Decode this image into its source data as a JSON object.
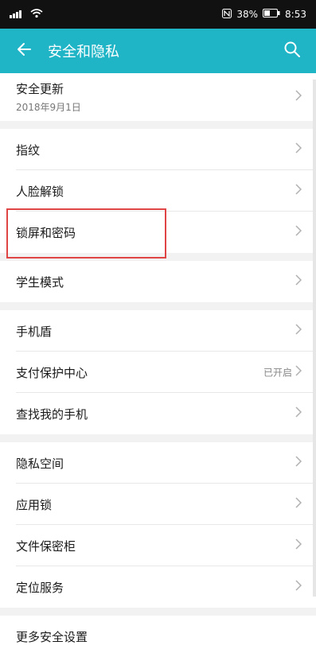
{
  "status_bar": {
    "battery_percent": "38%",
    "time": "8:53"
  },
  "app_bar": {
    "title": "安全和隐私"
  },
  "groups": [
    [
      {
        "label": "安全更新",
        "sub": "2018年9月1日"
      }
    ],
    [
      {
        "label": "指纹"
      },
      {
        "label": "人脸解锁"
      },
      {
        "label": "锁屏和密码"
      }
    ],
    [
      {
        "label": "学生模式"
      }
    ],
    [
      {
        "label": "手机盾"
      },
      {
        "label": "支付保护中心",
        "status": "已开启"
      },
      {
        "label": "查找我的手机"
      }
    ],
    [
      {
        "label": "隐私空间"
      },
      {
        "label": "应用锁"
      },
      {
        "label": "文件保密柜"
      },
      {
        "label": "定位服务"
      }
    ],
    [
      {
        "label": "更多安全设置"
      }
    ]
  ],
  "highlight": {
    "target": "锁屏和密码",
    "color": "#e04545"
  },
  "colors": {
    "accent": "#1fb4c6"
  }
}
